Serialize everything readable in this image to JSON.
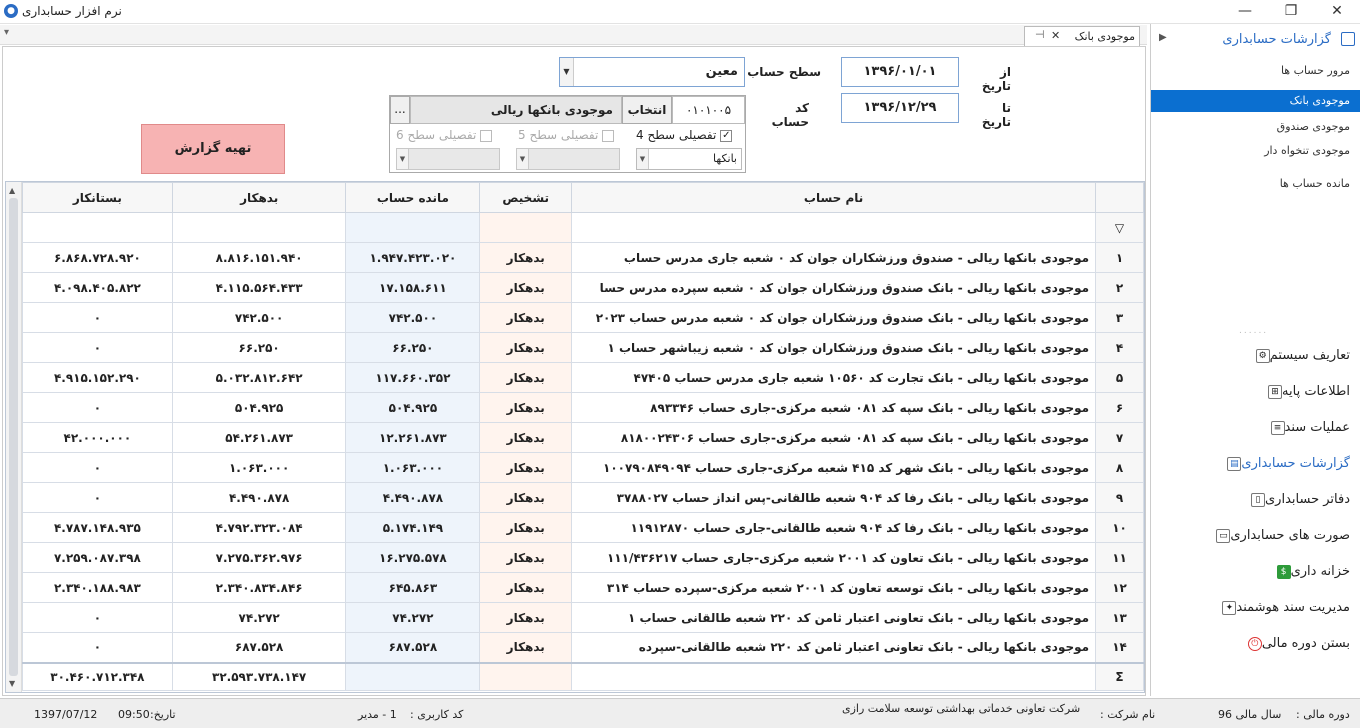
{
  "window": {
    "title": "نرم افزار حسابداری",
    "app_icon": "app-logo-icon"
  },
  "tab": {
    "label": "موجودی بانک"
  },
  "form": {
    "from_date_label": "از تاریخ",
    "from_date": "۱۳۹۶/۰۱/۰۱",
    "to_date_label": "تا تاریخ",
    "to_date": "۱۳۹۶/۱۲/۲۹",
    "level_label": "سطح حساب",
    "level_value": "معین",
    "account_code_label": "کد حساب",
    "account_code": "۰۱۰۱۰۰۵",
    "select_button": "انتخاب",
    "account_name": "موجودی بانکها ریالی",
    "ellipsis": "...",
    "check1": "تفصیلی سطح 4",
    "check2": "تفصیلی سطح 5",
    "check3": "تفصیلی سطح 6",
    "check1_value": "بانکها",
    "report_button": "تهیه گزارش"
  },
  "grid": {
    "headers": {
      "name": "نام حساب",
      "tashkhis": "تشخیص",
      "balance": "مانده حساب",
      "debit": "بدهکار",
      "credit": "بستانکار"
    },
    "rows": [
      {
        "idx": "۱",
        "name": "موجودی بانکها ریالی - صندوق ورزشکاران جوان کد ۰ شعبه جاری مدرس حساب",
        "tashkhis": "بدهکار",
        "balance": "۱.۹۴۷.۴۲۳.۰۲۰",
        "debit": "۸.۸۱۶.۱۵۱.۹۴۰",
        "credit": "۶.۸۶۸.۷۲۸.۹۲۰"
      },
      {
        "idx": "۲",
        "name": "موجودی بانکها ریالی - بانک صندوق ورزشکاران جوان کد ۰ شعبه سپرده مدرس حسا",
        "tashkhis": "بدهکار",
        "balance": "۱۷.۱۵۸.۶۱۱",
        "debit": "۴.۱۱۵.۵۶۴.۴۳۳",
        "credit": "۴.۰۹۸.۴۰۵.۸۲۲"
      },
      {
        "idx": "۳",
        "name": "موجودی بانکها ریالی - بانک صندوق ورزشکاران جوان کد ۰ شعبه مدرس حساب ۲۰۲۳",
        "tashkhis": "بدهکار",
        "balance": "۷۴۲.۵۰۰",
        "debit": "۷۴۲.۵۰۰",
        "credit": "۰"
      },
      {
        "idx": "۴",
        "name": "موجودی بانکها ریالی - بانک صندوق ورزشکاران جوان کد ۰ شعبه زیباشهر حساب ۱",
        "tashkhis": "بدهکار",
        "balance": "۶۶.۲۵۰",
        "debit": "۶۶.۲۵۰",
        "credit": "۰"
      },
      {
        "idx": "۵",
        "name": "موجودی بانکها ریالی - بانک تجارت کد ۱۰۵۶۰ شعبه جاری مدرس حساب ۴۷۴۰۵",
        "tashkhis": "بدهکار",
        "balance": "۱۱۷.۶۶۰.۳۵۲",
        "debit": "۵.۰۳۲.۸۱۲.۶۴۲",
        "credit": "۴.۹۱۵.۱۵۲.۲۹۰"
      },
      {
        "idx": "۶",
        "name": "موجودی بانکها ریالی - بانک سپه کد ۰۸۱ شعبه مرکزی-جاری حساب ۸۹۳۳۴۶",
        "tashkhis": "بدهکار",
        "balance": "۵۰۴.۹۲۵",
        "debit": "۵۰۴.۹۲۵",
        "credit": "۰"
      },
      {
        "idx": "۷",
        "name": "موجودی بانکها ریالی - بانک سپه کد ۰۸۱ شعبه مرکزی-جاری حساب ۸۱۸۰۰۲۴۳۰۶",
        "tashkhis": "بدهکار",
        "balance": "۱۲.۲۶۱.۸۷۳",
        "debit": "۵۴.۲۶۱.۸۷۳",
        "credit": "۴۲.۰۰۰.۰۰۰"
      },
      {
        "idx": "۸",
        "name": "موجودی بانکها ریالی - بانک شهر کد ۴۱۵ شعبه مرکزی-جاری حساب ۱۰۰۷۹۰۸۴۹۰۹۴",
        "tashkhis": "بدهکار",
        "balance": "۱.۰۶۳.۰۰۰",
        "debit": "۱.۰۶۳.۰۰۰",
        "credit": "۰"
      },
      {
        "idx": "۹",
        "name": "موجودی بانکها ریالی - بانک رفا کد ۹۰۴ شعبه طالقانی-پس انداز حساب ۳۷۸۸۰۲۷",
        "tashkhis": "بدهکار",
        "balance": "۴.۴۹۰.۸۷۸",
        "debit": "۴.۴۹۰.۸۷۸",
        "credit": "۰"
      },
      {
        "idx": "۱۰",
        "name": "موجودی بانکها ریالی - بانک رفا کد ۹۰۴ شعبه طالقانی-جاری حساب ۱۱۹۱۲۸۷۰",
        "tashkhis": "بدهکار",
        "balance": "۵.۱۷۴.۱۴۹",
        "debit": "۴.۷۹۲.۳۲۳.۰۸۴",
        "credit": "۴.۷۸۷.۱۴۸.۹۳۵"
      },
      {
        "idx": "۱۱",
        "name": "موجودی بانکها ریالی - بانک تعاون کد ۲۰۰۱ شعبه مرکزی-جاری حساب ۱۱۱/۴۳۶۲۱۷",
        "tashkhis": "بدهکار",
        "balance": "۱۶.۲۷۵.۵۷۸",
        "debit": "۷.۲۷۵.۳۶۲.۹۷۶",
        "credit": "۷.۲۵۹.۰۸۷.۳۹۸"
      },
      {
        "idx": "۱۲",
        "name": "موجودی بانکها ریالی - بانک توسعه تعاون کد ۲۰۰۱ شعبه مرکزی-سپرده حساب ۳۱۴",
        "tashkhis": "بدهکار",
        "balance": "۶۴۵.۸۶۳",
        "debit": "۲.۳۴۰.۸۳۴.۸۴۶",
        "credit": "۲.۳۴۰.۱۸۸.۹۸۳"
      },
      {
        "idx": "۱۳",
        "name": "موجودی بانکها ریالی - بانک تعاونی اعتبار ثامن کد ۲۲۰ شعبه طالقانی حساب ۱",
        "tashkhis": "بدهکار",
        "balance": "۷۴.۲۷۲",
        "debit": "۷۴.۲۷۲",
        "credit": "۰"
      },
      {
        "idx": "۱۴",
        "name": "موجودی بانکها ریالی - بانک تعاونی اعتبار ثامن کد ۲۲۰ شعبه طالقانی-سپرده",
        "tashkhis": "بدهکار",
        "balance": "۶۸۷.۵۲۸",
        "debit": "۶۸۷.۵۲۸",
        "credit": "۰"
      }
    ],
    "totals": {
      "symbol": "Σ",
      "debit": "۳۲.۵۹۳.۷۳۸.۱۴۷",
      "credit": "۳۰.۴۶۰.۷۱۲.۳۴۸"
    }
  },
  "sidebar": {
    "header": "گزارشات حسابداری",
    "sub_items": [
      "مرور حساب ها",
      "موجودی بانک",
      "موجودی صندوق",
      "موجودی تنخواه دار",
      "مانده حساب ها"
    ],
    "main_items": [
      "تعاریف سیستم",
      "اطلاعات پایه",
      "عملیات سند",
      "گزارشات حسابداری",
      "دفاتر حسابداری",
      "صورت های حسابداری",
      "خزانه داری",
      "مدیریت سند هوشمند",
      "بستن دوره مالی"
    ]
  },
  "status": {
    "period_label": "دوره مالی :",
    "period_value": "سال مالی 96",
    "company_label": "نام شرکت :",
    "company_value": "شرکت تعاونی خدماتی بهداشتی توسعه سلامت رازی",
    "user_label": "کد کاربری :",
    "user_value": "1 - مدیر",
    "date_label": "تاریخ:",
    "time": "09:50",
    "date": "1397/07/12"
  }
}
